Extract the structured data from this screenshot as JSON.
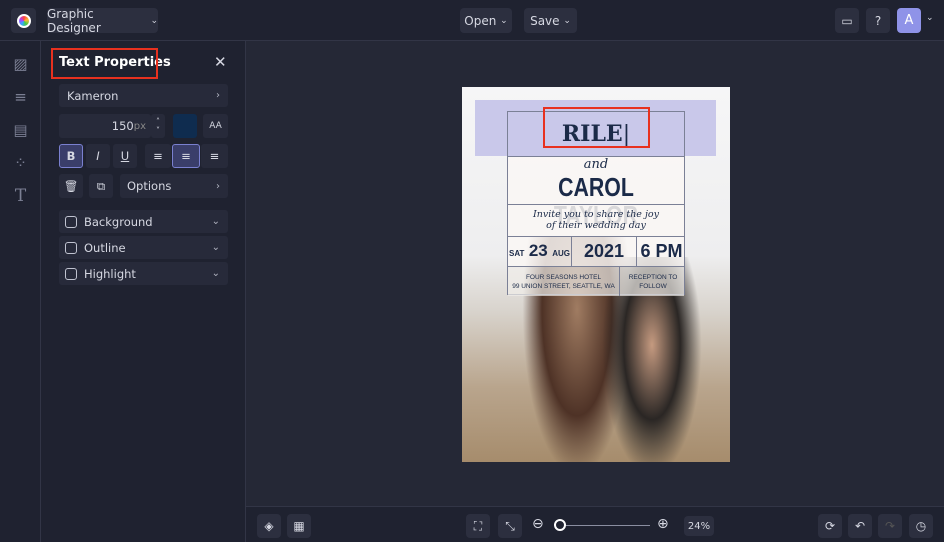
{
  "topbar": {
    "mode": "Graphic Designer",
    "open": "Open",
    "save": "Save",
    "avatar": "A"
  },
  "panel": {
    "title": "Text Properties",
    "font": "Kameron",
    "size": "150",
    "unit": "px",
    "color": "#0f2c4f",
    "options": "Options",
    "toggles": [
      {
        "label": "Background",
        "checked": false
      },
      {
        "label": "Outline",
        "checked": false
      },
      {
        "label": "Highlight",
        "checked": false
      }
    ]
  },
  "poster": {
    "name1": "RILE",
    "and": "and",
    "name2": "CAROL TAYLOR",
    "invite1": "Invite you to share the joy",
    "invite2": "of their wedding day",
    "day": "SAT",
    "date": "23",
    "month": "AUG",
    "year": "2021",
    "time": "6 PM",
    "venue1": "FOUR SEASONS HOTEL",
    "venue2": "99 UNION STREET, SEATTLE, WA",
    "reception1": "RECEPTION TO",
    "reception2": "FOLLOW"
  },
  "bottom": {
    "zoom": "24%",
    "zoom_fraction": 0.02
  }
}
